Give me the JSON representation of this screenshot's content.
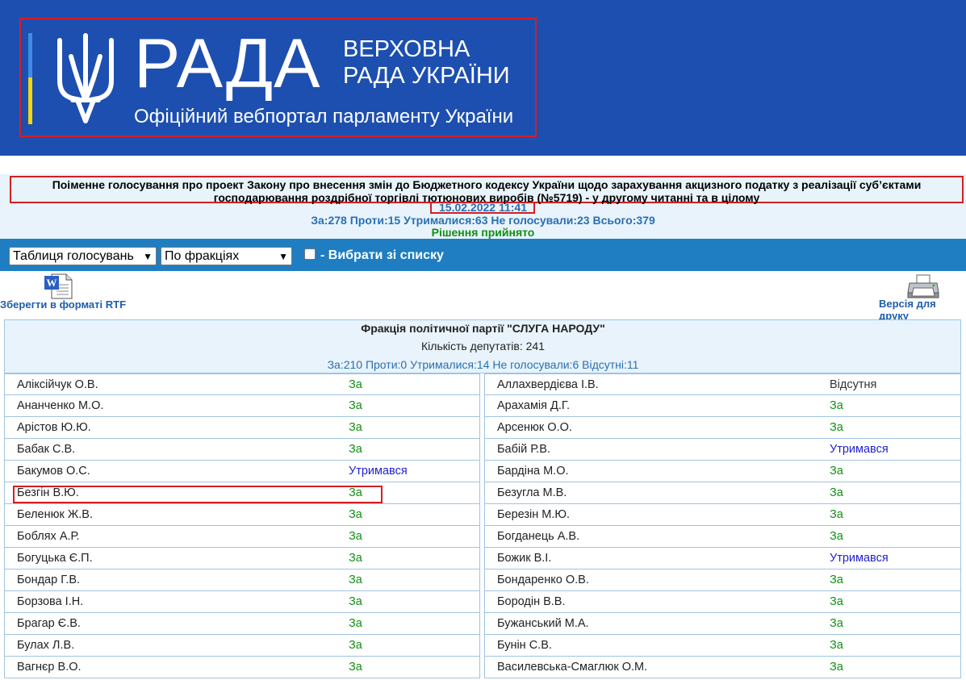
{
  "header": {
    "logo_word": "РАДА",
    "subtitle_line1": "ВЕРХОВНА",
    "subtitle_line2": "РАДА УКРАЇНИ",
    "portal_name": "Офіційний вебпортал парламенту України"
  },
  "vote": {
    "title": "Поіменне голосування про проект Закону про внесення змін до Бюджетного кодексу України щодо зарахування акцизного податку з реалізації суб’єктами господарювання роздрібної торгівлі тютюнових виробів (№5719) - у другому читанні та в цілому",
    "datetime": "15.02.2022 11:41",
    "totals": "За:278 Проти:15 Утрималися:63 Не голосували:23 Всього:379",
    "decision": "Рішення прийнято"
  },
  "toolbar": {
    "view_select": "Таблиця голосувань",
    "group_select": "По фракціях",
    "choose_label": "- Вибрати зі списку"
  },
  "actions": {
    "rtf_label": "Зберегти в форматі RTF",
    "print_label": "Версія для друку"
  },
  "faction": {
    "name": "Фракція політичної партії \"СЛУГА НАРОДУ\"",
    "count": "Кількість депутатів: 241",
    "totals": "За:210 Проти:0 Утрималися:14 Не голосували:6 Відсутні:11"
  },
  "deputies_left": [
    {
      "name": "Аліксійчук О.В.",
      "vote": "За"
    },
    {
      "name": "Ананченко М.О.",
      "vote": "За"
    },
    {
      "name": "Арістов Ю.Ю.",
      "vote": "За"
    },
    {
      "name": "Бабак С.В.",
      "vote": "За"
    },
    {
      "name": "Бакумов О.С.",
      "vote": "Утримався"
    },
    {
      "name": "Безгін В.Ю.",
      "vote": "За"
    },
    {
      "name": "Беленюк Ж.В.",
      "vote": "За"
    },
    {
      "name": "Боблях А.Р.",
      "vote": "За"
    },
    {
      "name": "Богуцька Є.П.",
      "vote": "За"
    },
    {
      "name": "Бондар Г.В.",
      "vote": "За"
    },
    {
      "name": "Борзова І.Н.",
      "vote": "За"
    },
    {
      "name": "Брагар Є.В.",
      "vote": "За"
    },
    {
      "name": "Булах Л.В.",
      "vote": "За"
    },
    {
      "name": "Вагнєр В.О.",
      "vote": "За"
    }
  ],
  "deputies_right": [
    {
      "name": "Аллахвердієва І.В.",
      "vote": "Відсутня"
    },
    {
      "name": "Арахамія Д.Г.",
      "vote": "За"
    },
    {
      "name": "Арсенюк О.О.",
      "vote": "За"
    },
    {
      "name": "Бабій Р.В.",
      "vote": "Утримався"
    },
    {
      "name": "Бардіна М.О.",
      "vote": "За"
    },
    {
      "name": "Безугла М.В.",
      "vote": "За"
    },
    {
      "name": "Березін М.Ю.",
      "vote": "За"
    },
    {
      "name": "Богданець А.В.",
      "vote": "За"
    },
    {
      "name": "Божик В.І.",
      "vote": "Утримався"
    },
    {
      "name": "Бондаренко О.В.",
      "vote": "За"
    },
    {
      "name": "Бородін В.В.",
      "vote": "За"
    },
    {
      "name": "Бужанський М.А.",
      "vote": "За"
    },
    {
      "name": "Бунін С.В.",
      "vote": "За"
    },
    {
      "name": "Василевська-Смаглюк О.М.",
      "vote": "За"
    }
  ],
  "colors": {
    "banner": "#1d4fb0",
    "toolbar": "#1f7ec2",
    "vote_for": "#118f13",
    "vote_abstain": "#1f1fd0",
    "highlight": "#d21f26"
  },
  "icons": {
    "emblem": "trident-emblem-icon",
    "rtf": "word-document-icon",
    "print": "printer-icon"
  }
}
